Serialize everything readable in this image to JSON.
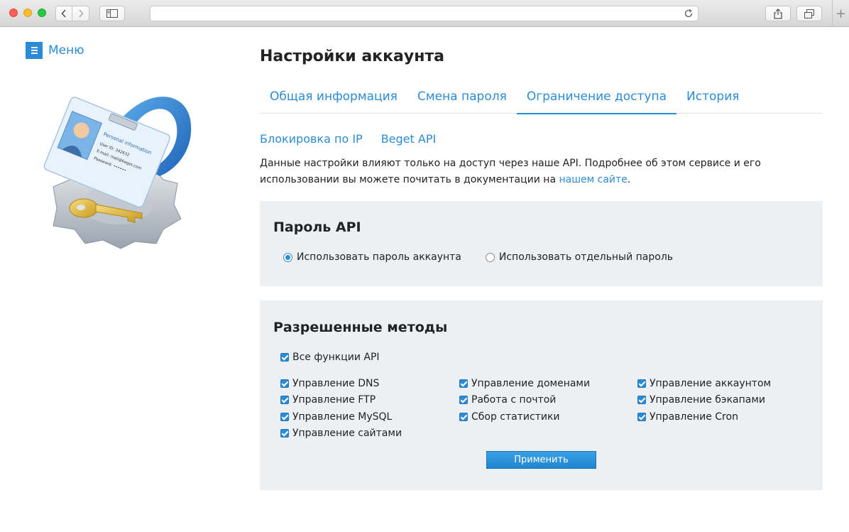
{
  "browser": {
    "newtab_symbol": "+"
  },
  "sidebar": {
    "menu_label": "Меню",
    "menu_icon_glyph": "≡"
  },
  "illustration": {
    "card_title": "Personal information",
    "card_lines": [
      "User ID: 342632",
      "E-mail: mail@beget.com",
      "Password: ••••••"
    ]
  },
  "page": {
    "title": "Настройки аккаунта"
  },
  "tabs": [
    {
      "label": "Общая информация",
      "active": false
    },
    {
      "label": "Смена пароля",
      "active": false
    },
    {
      "label": "Ограничение доступа",
      "active": true
    },
    {
      "label": "История",
      "active": false
    }
  ],
  "subtabs": [
    {
      "label": "Блокировка по IP"
    },
    {
      "label": "Beget API"
    }
  ],
  "description": {
    "text_1": "Данные настройки влияют только на доступ через наше API. Подробнее об этом сервисе и его использовании вы можете почитать в документации на ",
    "link": "нашем сайте",
    "text_2": "."
  },
  "api_password": {
    "title": "Пароль API",
    "options": [
      {
        "label": "Использовать пароль аккаунта",
        "selected": true
      },
      {
        "label": "Использовать отдельный пароль",
        "selected": false
      }
    ]
  },
  "methods": {
    "title": "Разрешенные методы",
    "all_label": "Все функции API",
    "columns": [
      [
        {
          "label": "Управление DNS",
          "checked": true
        },
        {
          "label": "Управление FTP",
          "checked": true
        },
        {
          "label": "Управление MySQL",
          "checked": true
        },
        {
          "label": "Управление сайтами",
          "checked": true
        }
      ],
      [
        {
          "label": "Управление доменами",
          "checked": true
        },
        {
          "label": "Работа с почтой",
          "checked": true
        },
        {
          "label": "Сбор статистики",
          "checked": true
        }
      ],
      [
        {
          "label": "Управление аккаунтом",
          "checked": true
        },
        {
          "label": "Управление бэкапами",
          "checked": true
        },
        {
          "label": "Управление Cron",
          "checked": true
        }
      ]
    ],
    "apply_label": "Применить"
  },
  "colors": {
    "accent": "#2b8bd6",
    "panel_bg": "#edf0f3"
  }
}
